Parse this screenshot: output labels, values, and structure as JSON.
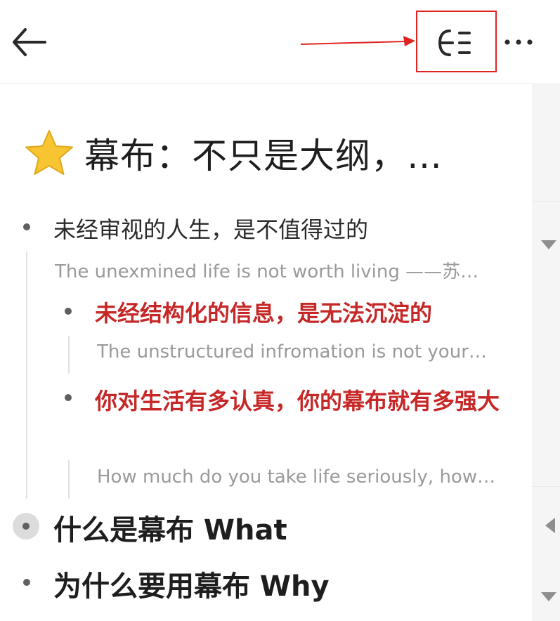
{
  "doc": {
    "title": "幕布：不只是大纲，…"
  },
  "outline": {
    "node1": {
      "text": "未经审视的人生，是不值得过的",
      "note": "The unexmined life is not worth living ——苏…"
    },
    "node1_1": {
      "text": "未经结构化的信息，是无法沉淀的",
      "note": "The unstructured infromation is not your…"
    },
    "node1_2": {
      "text": "你对生活有多认真，你的幕布就有多强大",
      "note": "How much do you take life seriously, how…"
    },
    "node2": {
      "text": "什么是幕布 What"
    },
    "node3": {
      "text": "为什么要用幕布 Why"
    }
  },
  "colors": {
    "highlight_text": "#c62828",
    "annotation_red": "#e02424",
    "star": "#f7c531"
  },
  "icons": {
    "back": "back-arrow-icon",
    "outline_view": "outline-view-icon",
    "more": "more-dots-icon",
    "star": "star-icon"
  }
}
